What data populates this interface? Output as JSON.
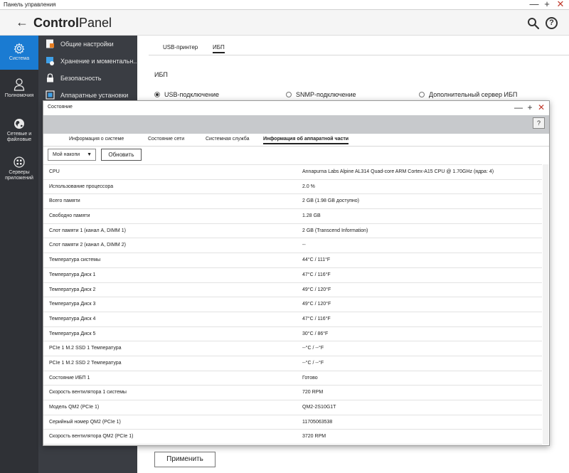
{
  "os": {
    "title": "Панель управления",
    "min": "—",
    "max": "+",
    "close": "✕"
  },
  "header": {
    "back": "←",
    "brand_bold": "Control",
    "brand_rest": "Panel",
    "help": "?"
  },
  "rail": [
    {
      "label": "Система",
      "icon": "gear-icon",
      "active": true
    },
    {
      "label": "Полномочия",
      "icon": "user-icon",
      "active": false
    },
    {
      "label": "Сетевые и файловые",
      "icon": "globe-icon",
      "active": false
    },
    {
      "label": "Серверы приложений",
      "icon": "apps-icon",
      "active": false
    }
  ],
  "submenu": [
    {
      "label": "Общие настройки",
      "icon": "settings-doc-icon"
    },
    {
      "label": "Хранение и моментальн...",
      "icon": "storage-icon"
    },
    {
      "label": "Безопасность",
      "icon": "lock-icon"
    },
    {
      "label": "Аппаратные установки",
      "icon": "hardware-icon"
    }
  ],
  "main": {
    "tabs": [
      "USB-принтер",
      "ИБП"
    ],
    "active_tab": 1,
    "section_title": "ИБП",
    "radios": [
      {
        "label": "USB-подключение",
        "checked": true
      },
      {
        "label": "SNMP-подключение",
        "checked": false
      },
      {
        "label": "Дополнительный сервер ИБП",
        "checked": false
      }
    ],
    "apply": "Применить"
  },
  "dialog": {
    "title": "Состояние",
    "min": "—",
    "max": "+",
    "close": "✕",
    "help": "?",
    "tabs": [
      "Информация о системе",
      "Состояние сети",
      "Системная служба",
      "Информация об аппаратной части"
    ],
    "active_tab": 3,
    "dropdown": "Мой накопи",
    "refresh": "Обновить",
    "rows": [
      {
        "name": "CPU",
        "value": "Annapurna Labs Alpine AL314 Quad-core ARM Cortex-A15 CPU @ 1.70GHz (ядра: 4)"
      },
      {
        "name": "Использование процессора",
        "value": "2.0 %"
      },
      {
        "name": "Всего памяти",
        "value": "2 GB (1.98 GB доступно)"
      },
      {
        "name": "Свободно памяти",
        "value": "1.28 GB"
      },
      {
        "name": "Слот памяти 1 (канал A, DIMM 1)",
        "value": "2 GB (Transcend Information)"
      },
      {
        "name": "Слот памяти 2 (канал A, DIMM 2)",
        "value": "--"
      },
      {
        "name": "Температура системы",
        "value": "44°C / 111°F"
      },
      {
        "name": "Температура Диск 1",
        "value": "47°C / 116°F"
      },
      {
        "name": "Температура Диск 2",
        "value": "49°C / 120°F"
      },
      {
        "name": "Температура Диск 3",
        "value": "49°C / 120°F"
      },
      {
        "name": "Температура Диск 4",
        "value": "47°C / 116°F"
      },
      {
        "name": "Температура Диск 5",
        "value": "30°C / 86°F"
      },
      {
        "name": "PCIe 1 M.2 SSD 1 Температура",
        "value": "--°C / --°F"
      },
      {
        "name": "PCIe 1 M.2 SSD 2 Температура",
        "value": "--°C / --°F"
      },
      {
        "name": "Состояние ИБП 1",
        "value": "Готово"
      },
      {
        "name": "Скорость вентилятора 1 системы",
        "value": "720 RPM"
      },
      {
        "name": "Модель QM2 (PCIe 1)",
        "value": "QM2-2S10G1T"
      },
      {
        "name": "Серийный номер QM2 (PCIe 1)",
        "value": "11705063538"
      },
      {
        "name": "Скорость вентилятора QM2 (PCIe 1)",
        "value": "3720 RPM"
      }
    ]
  },
  "colors": {
    "rail_bg": "#2f3136",
    "rail_active": "#1a7bd2",
    "submenu_bg": "#3a3d43",
    "close_red": "#c0392b"
  }
}
